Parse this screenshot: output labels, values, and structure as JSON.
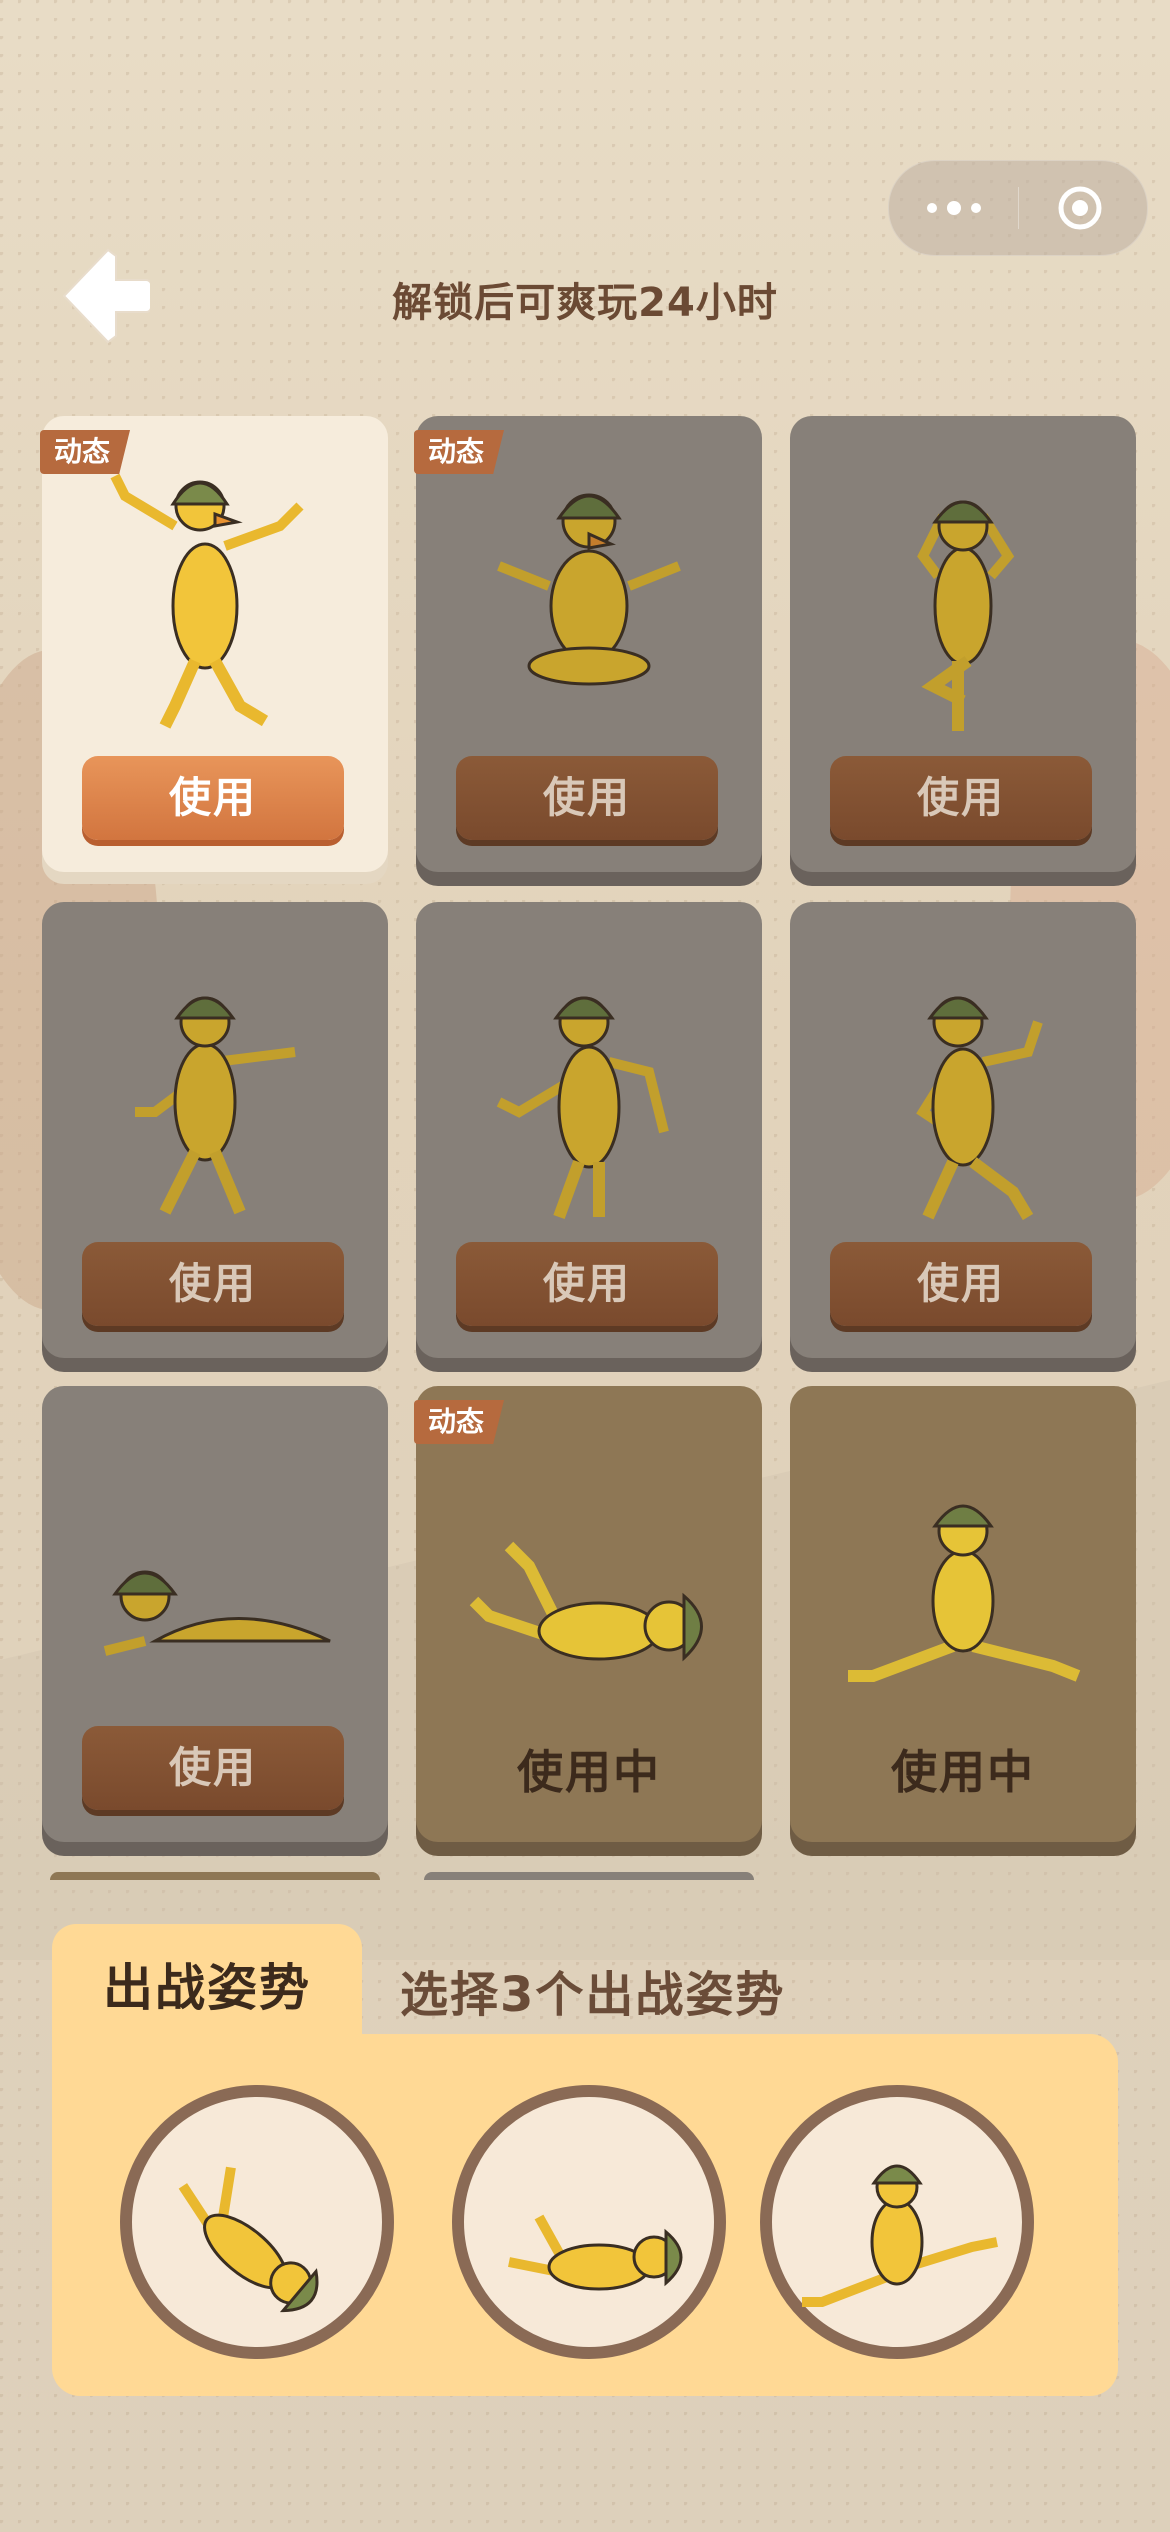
{
  "header": {
    "title": "解锁后可爽玩24小时",
    "back_icon": "back-arrow-icon",
    "menu_icon": "more-dots-icon",
    "close_icon": "target-close-icon"
  },
  "poses": [
    {
      "badge": "动态",
      "button": "使用",
      "state": "selected",
      "icon": "duck-rock-on-pose"
    },
    {
      "badge": "动态",
      "button": "使用",
      "state": "locked",
      "icon": "duck-lotus-pose"
    },
    {
      "badge": "",
      "button": "使用",
      "state": "locked",
      "icon": "duck-tree-pose"
    },
    {
      "badge": "",
      "button": "使用",
      "state": "locked",
      "icon": "duck-lean-pose"
    },
    {
      "badge": "",
      "button": "使用",
      "state": "locked",
      "icon": "duck-dance-pose"
    },
    {
      "badge": "",
      "button": "使用",
      "state": "locked",
      "icon": "duck-strut-pose"
    },
    {
      "badge": "",
      "button": "使用",
      "state": "locked",
      "icon": "duck-crawl-pose"
    },
    {
      "badge": "动态",
      "button": "使用中",
      "state": "inuse",
      "icon": "duck-flip-pose"
    },
    {
      "badge": "",
      "button": "使用中",
      "state": "inuse",
      "icon": "duck-split-pose"
    }
  ],
  "battle_panel": {
    "tab_label": "出战姿势",
    "hint": "选择3个出战姿势",
    "slots": [
      {
        "icon": "duck-flip-pose"
      },
      {
        "icon": "duck-flip-pose"
      },
      {
        "icon": "duck-split-pose"
      }
    ]
  },
  "colors": {
    "accent_orange": "#d2753f",
    "locked_card": "#878079",
    "inuse_card": "#8e7755",
    "panel_yellow": "#ffd995",
    "text_brown": "#6b4a34"
  }
}
